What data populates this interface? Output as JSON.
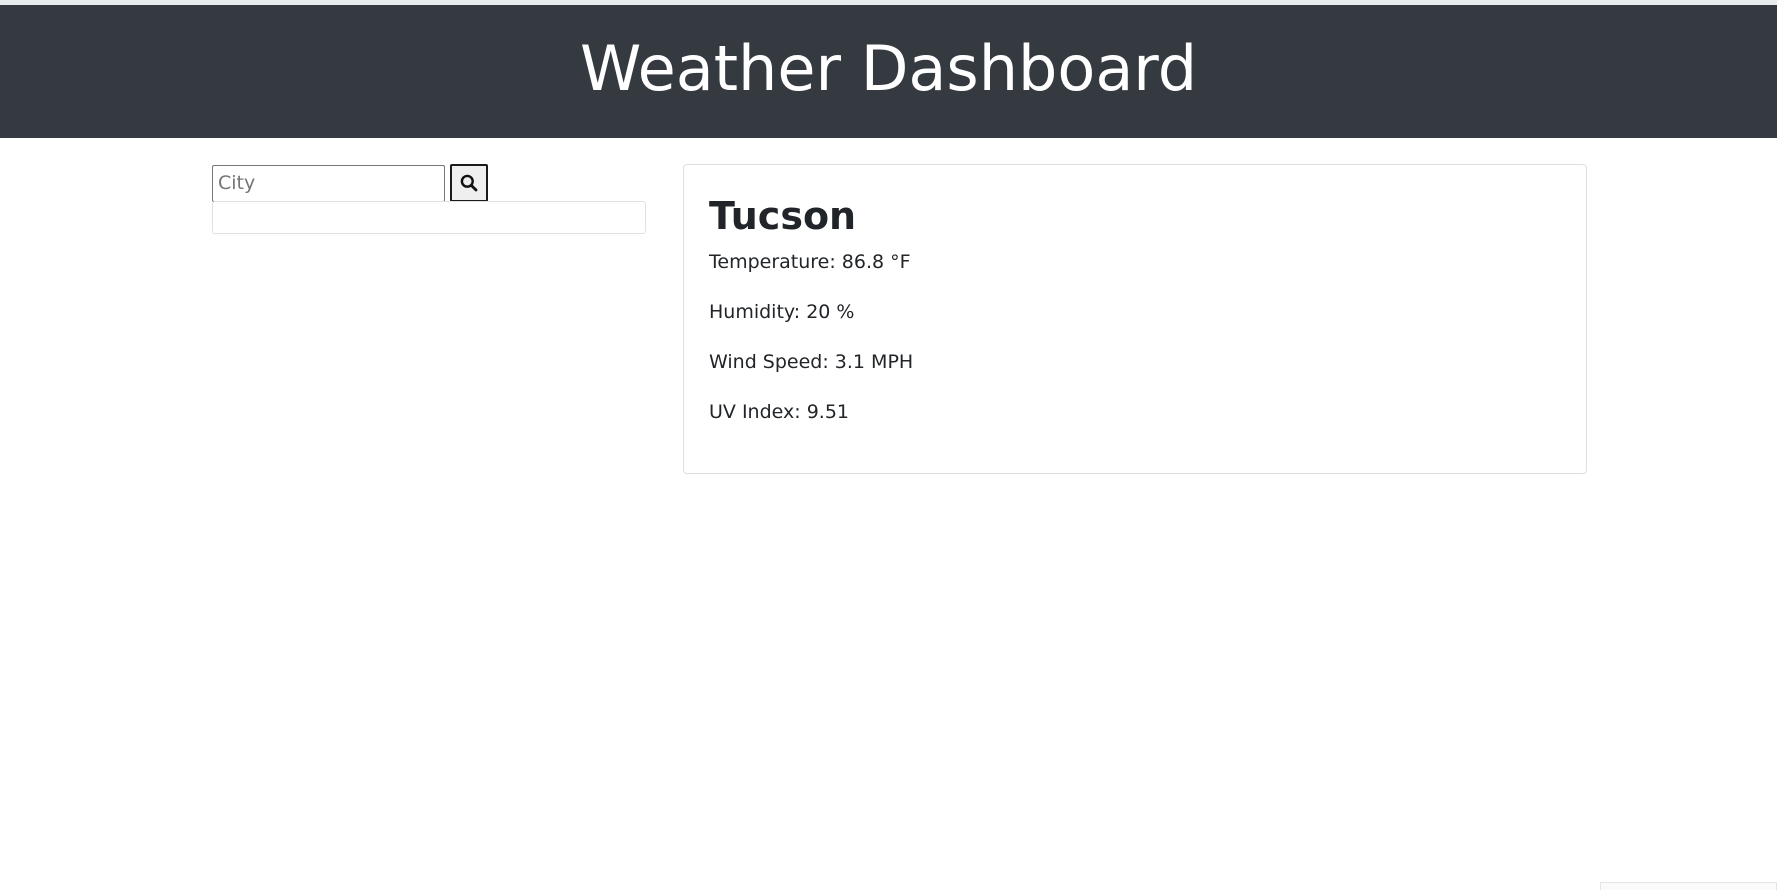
{
  "header": {
    "title": "Weather Dashboard"
  },
  "search": {
    "placeholder": "City",
    "value": "",
    "button_icon": "search-icon"
  },
  "history": {
    "items": []
  },
  "current": {
    "city": "Tucson",
    "temperature": "Temperature: 86.8 °F",
    "humidity": "Humidity: 20 %",
    "wind_speed": "Wind Speed: 3.1 MPH",
    "uv_index": "UV Index: 9.51"
  },
  "colors": {
    "header_bg": "#343a40",
    "header_text": "#ffffff",
    "body_text": "#212529"
  }
}
